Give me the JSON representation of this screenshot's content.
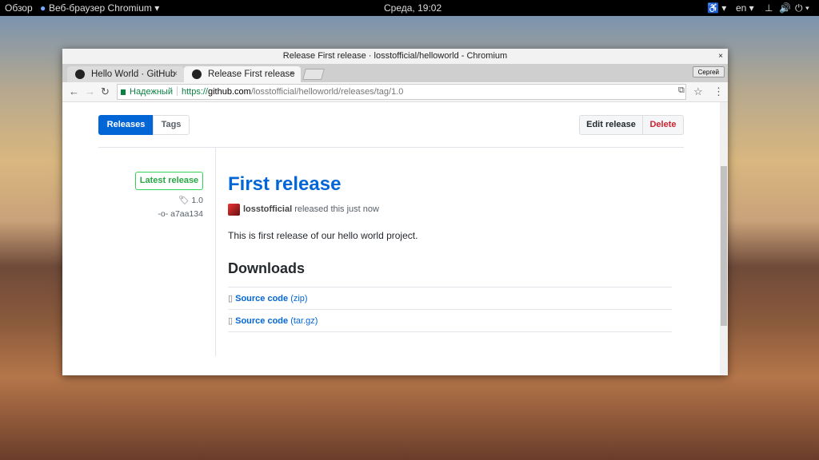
{
  "topbar": {
    "overview": "Обзор",
    "app": "Веб-браузер Chromium ▾",
    "clock": "Среда, 19:02",
    "lang": "en ▾"
  },
  "window": {
    "title": "Release First release · losstofficial/helloworld - Chromium",
    "close": "×"
  },
  "tabs": [
    {
      "label": "Hello World · GitHub",
      "close": "×"
    },
    {
      "label": "Release First release",
      "close": "×"
    }
  ],
  "user_button": "Сергей",
  "toolbar": {
    "secure": "Надежный",
    "url_scheme": "https://",
    "url_host": "github.com",
    "url_path": "/losstofficial/helloworld/releases/tag/1.0"
  },
  "page": {
    "tab_releases": "Releases",
    "tab_tags": "Tags",
    "edit": "Edit release",
    "delete": "Delete",
    "latest": "Latest release",
    "tag": "1.0",
    "commit": "a7aa134",
    "title": "First release",
    "author": "losstofficial",
    "released": "released this just now",
    "body": "This is first release of our hello world project.",
    "downloads": "Downloads",
    "assets": [
      {
        "name": "Source code",
        "ext": "(zip)"
      },
      {
        "name": "Source code",
        "ext": "(tar.gz)"
      }
    ]
  }
}
